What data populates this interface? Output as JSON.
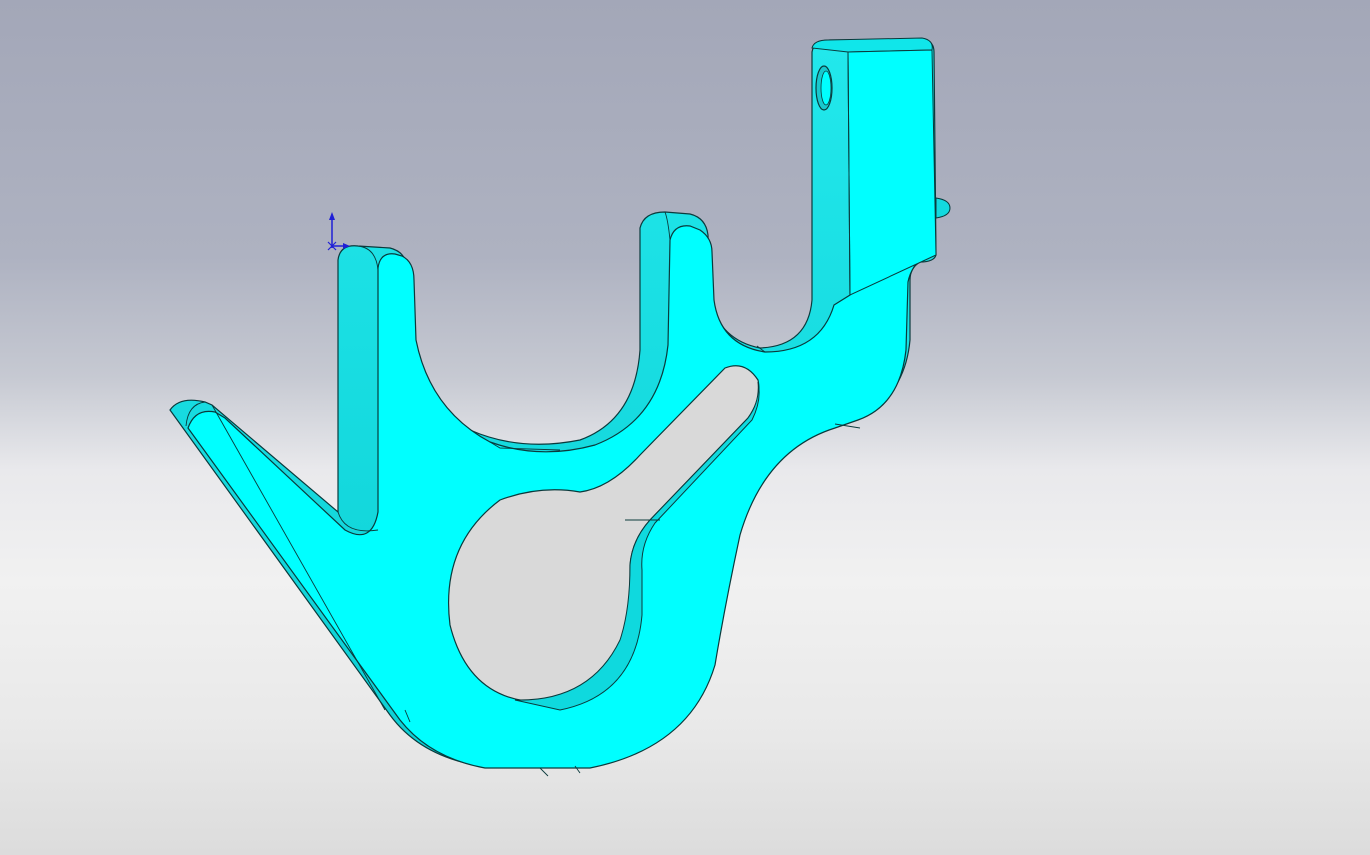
{
  "viewport": {
    "background_top": "#a3a7b8",
    "background_bottom": "#e6e6e6"
  },
  "model": {
    "face_color": "#00ffff",
    "side_color": "#14dfe3",
    "edge_color": "#0a3a3c"
  },
  "triad": {
    "axis_color": "#1f1fd6",
    "icon": "origin-triad-icon"
  }
}
